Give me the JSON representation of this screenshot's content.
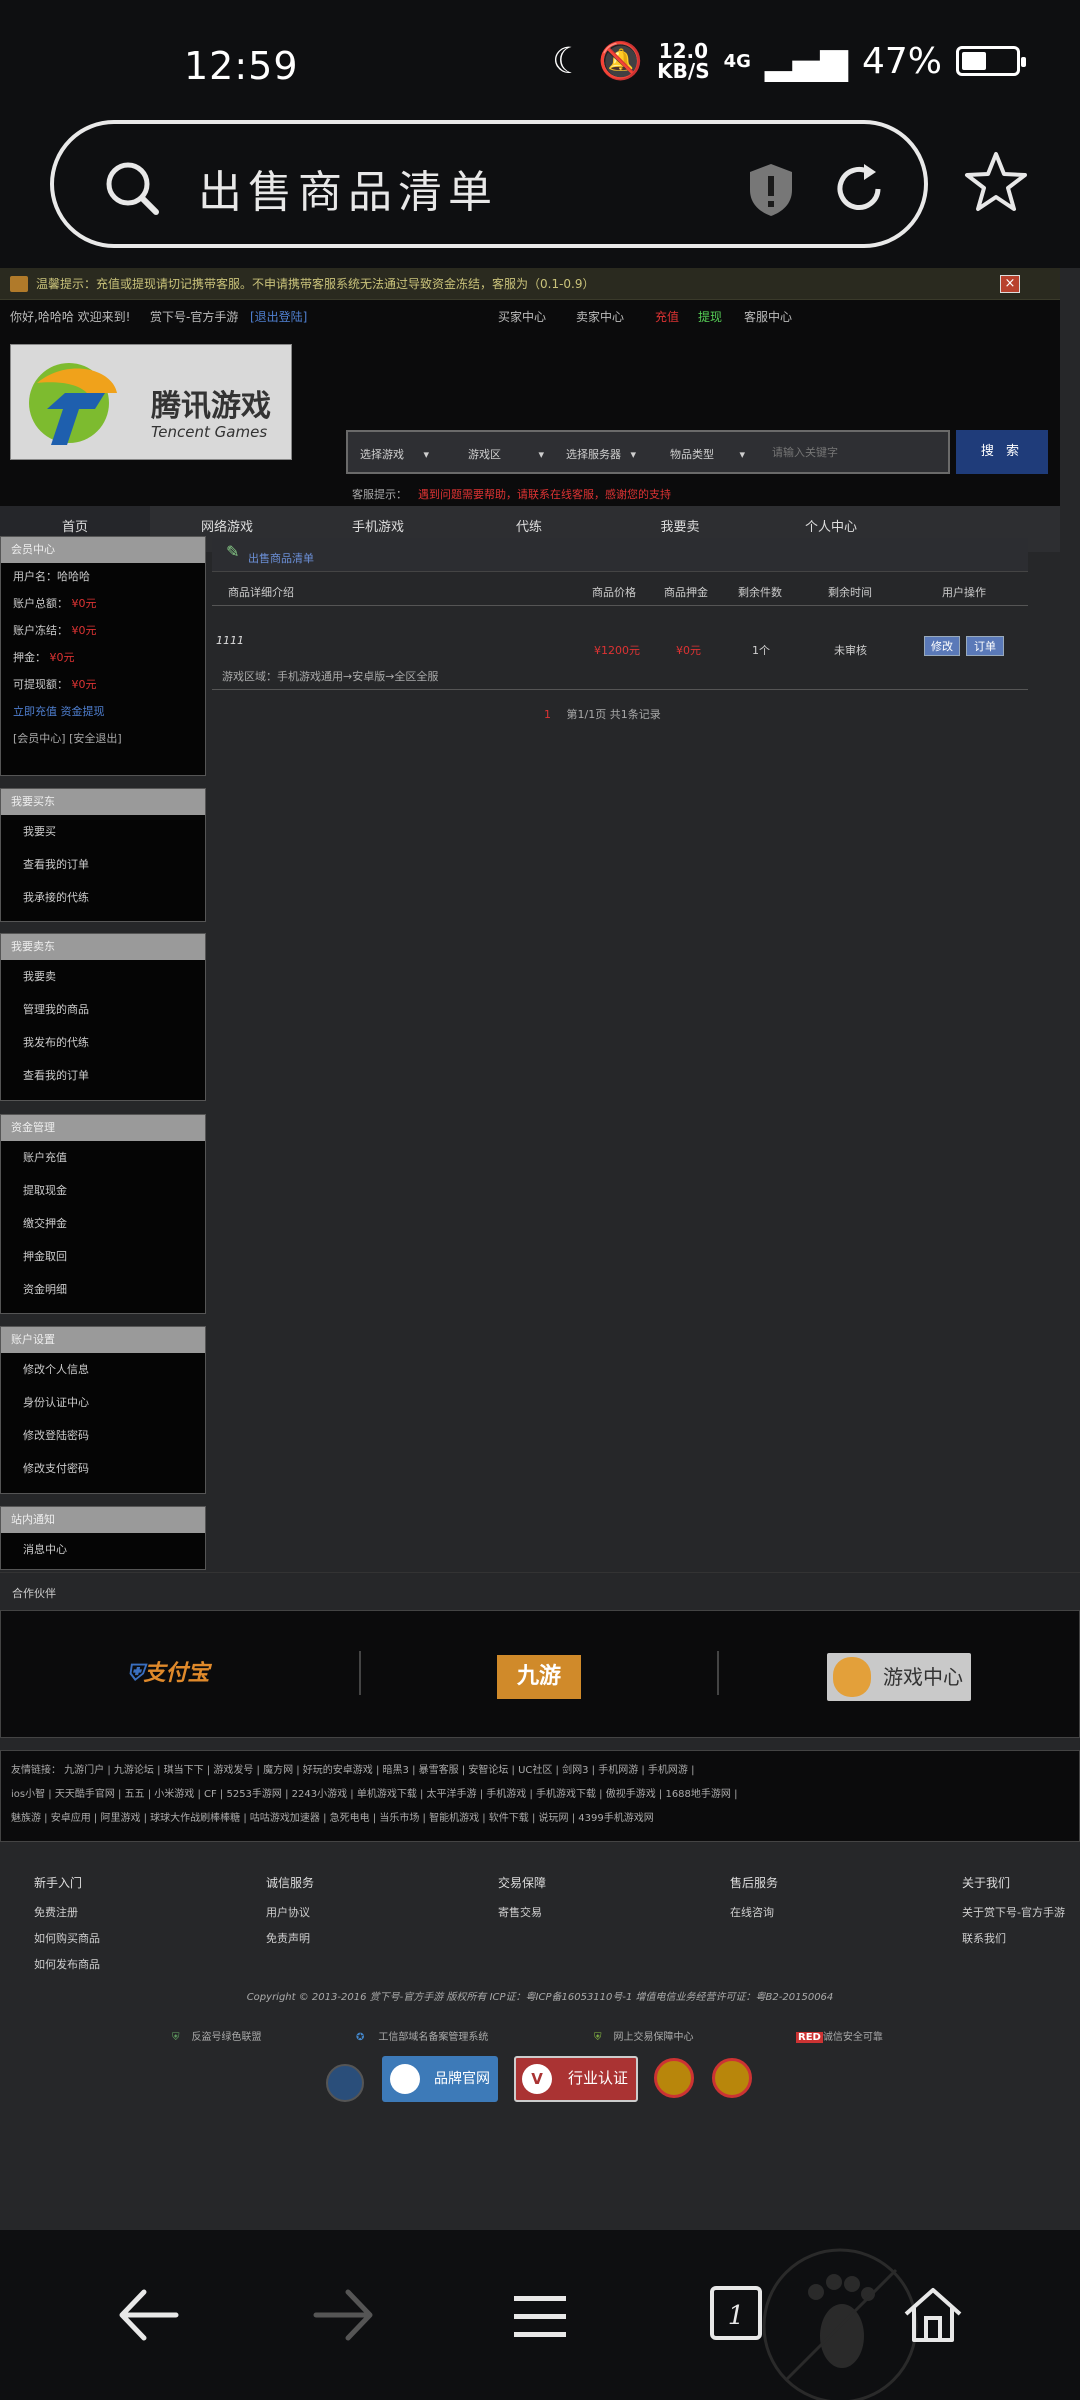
{
  "status": {
    "time": "12:59",
    "speed_value": "12.0",
    "speed_unit": "KB/S",
    "network": "4G",
    "battery": "47%",
    "battery_level": 0.47
  },
  "browser": {
    "url_text": "出售商品清单"
  },
  "notice": {
    "text": "温馨提示：充值或提现请切记携带客服。不申请携带客服系统无法通过导致资金冻结，客服为（0.1-0.9）"
  },
  "topnav": {
    "greeting": "你好,哈哈哈 欢迎来到!",
    "site": "赏下号-官方手游",
    "logout": "[退出登陆]",
    "links": [
      "买家中心",
      "卖家中心",
      "充值",
      "提现",
      "客服中心"
    ]
  },
  "header": {
    "logo_cn": "腾讯游戏",
    "logo_en": "Tencent Games",
    "selects": [
      "选择游戏",
      "游戏区",
      "选择服务器",
      "物品类型"
    ],
    "search_placeholder": "请输入关键字",
    "search_button": "搜 索",
    "warn_label": "客服提示：",
    "warn_text": "遇到问题需要帮助，请联系在线客服，感谢您的支持"
  },
  "mainnav": [
    "首页",
    "网络游戏",
    "手机游戏",
    "代练",
    "我要卖",
    "个人中心"
  ],
  "sidebar": [
    {
      "title": "会员中心",
      "items": [
        "用户名：哈哈哈",
        "账户总额：  ¥0元",
        "账户冻结：  ¥0元",
        "押金：  ¥0元",
        "可提现额：  ¥0元",
        "立即充值  资金提现",
        "[会员中心]  [安全退出]"
      ]
    },
    {
      "title": "我要买东",
      "items": [
        "我要买",
        "查看我的订单",
        "我承接的代练"
      ]
    },
    {
      "title": "我要卖东",
      "items": [
        "我要卖",
        "管理我的商品",
        "我发布的代练",
        "查看我的订单"
      ]
    },
    {
      "title": "资金管理",
      "items": [
        "账户充值",
        "提取现金",
        "缴交押金",
        "押金取回",
        "资金明细"
      ]
    },
    {
      "title": "账户设置",
      "items": [
        "修改个人信息",
        "身份认证中心",
        "修改登陆密码",
        "修改支付密码"
      ]
    },
    {
      "title": "站内通知",
      "items": [
        "消息中心"
      ]
    }
  ],
  "content": {
    "title": "出售商品清单",
    "headers": [
      "商品详细介绍",
      "商品价格",
      "商品押金",
      "剩余件数",
      "剩余时间",
      "用户操作"
    ],
    "rows": [
      {
        "name": "1111",
        "price": "¥1200元",
        "deposit": "¥0元",
        "count": "1个",
        "time": "未审核",
        "region": "游戏区域：手机游戏通用→安卓版→全区全服",
        "btn_edit": "修改",
        "btn_order": "订单"
      }
    ],
    "pager_num": "1",
    "pager": "第1/1页 共1条记录"
  },
  "partners": {
    "title": "合作伙伴",
    "logos": [
      "支付宝",
      "九游",
      "游戏中心"
    ]
  },
  "links": {
    "lines": [
      "友情链接：  九游门户  |  九游论坛  |  琪当下下  |  游戏发号  |  魔方网  |  好玩的安卓游戏  |  暗黑3  |  暴雪客服  |  安智论坛  |  UC社区  |  剑网3  |  手机网游  |  手机网游  |",
      "ios小智  |  天天酷手官网  |  五五  |  小米游戏  |  CF  |  5253手游网  |  2243小游戏  |  单机游戏下载  |  太平洋手游  |  手机游戏  |  手机游戏下载  |  傲视手游戏  |  1688地手游网  |",
      "魅族游  |  安卓应用  |  阿里游戏  |  球球大作战刷棒棒糖  |  咕咕游戏加速器  |  急死电电  |  当乐市场  |  智能机游戏  |  软件下载  |  说玩网  |  4399手机游戏网"
    ]
  },
  "footer": {
    "columns": [
      {
        "title": "新手入门",
        "items": [
          "免费注册",
          "如何购买商品",
          "如何发布商品"
        ]
      },
      {
        "title": "诚信服务",
        "items": [
          "用户协议",
          "免责声明"
        ]
      },
      {
        "title": "交易保障",
        "items": [
          "寄售交易"
        ]
      },
      {
        "title": "售后服务",
        "items": [
          "在线咨询"
        ]
      },
      {
        "title": "关于我们",
        "items": [
          "关于赏下号-官方手游",
          "联系我们"
        ]
      }
    ],
    "copyright": "Copyright © 2013-2016 赏下号-官方手游  版权所有  ICP证：粤ICP备16053110号-1  增值电信业务经营许可证：粤B2-20150064",
    "badges": [
      "反盗号绿色联盟",
      "工信部域名备案管理系统",
      "网上交易保障中心",
      "诚信安全可靠"
    ],
    "badge_red": "RED",
    "seals": [
      "品牌官网",
      "行业认证"
    ]
  },
  "colors": {
    "accent": "#1f3c7a",
    "warning": "#d33",
    "highlight": "#3d5d96"
  }
}
